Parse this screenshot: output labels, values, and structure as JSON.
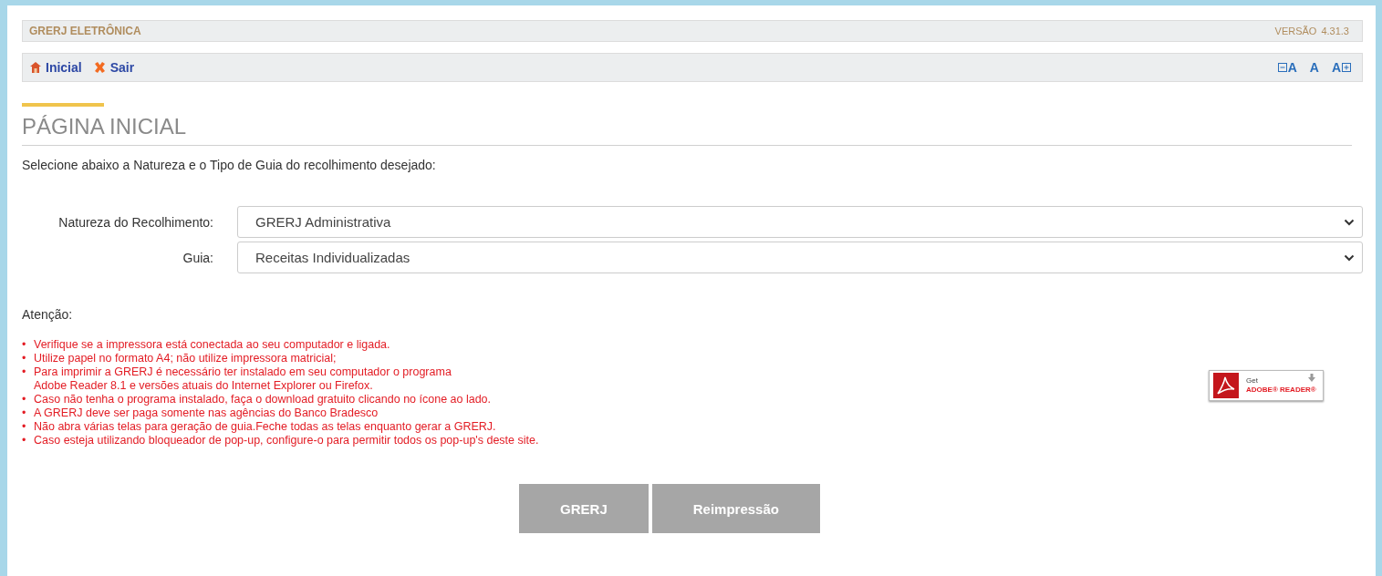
{
  "header": {
    "title": "GRERJ ELETRÔNICA",
    "version_label": "VERSÃO",
    "version": "4.31.3"
  },
  "nav": [
    {
      "kind": "home",
      "label": "Inicial"
    },
    {
      "kind": "exit",
      "label": "Sair"
    }
  ],
  "font_controls": [
    {
      "kind": "decrease",
      "label": "A"
    },
    {
      "kind": "normal",
      "label": "A"
    },
    {
      "kind": "increase",
      "label": "A"
    }
  ],
  "page_title": "PÁGINA INICIAL",
  "intro": "Selecione abaixo a Natureza e o Tipo de Guia do recolhimento desejado:",
  "fields": [
    {
      "label": "Natureza do Recolhimento:",
      "value": "GRERJ Administrativa"
    },
    {
      "label": "Guia:",
      "value": "Receitas Individualizadas"
    }
  ],
  "attention": {
    "title": "Atenção:",
    "marker": "•",
    "items": [
      "Verifique se a impressora está conectada ao seu computador e ligada.",
      "Utilize papel no formato A4; não utilize impressora matricial;",
      "Para imprimir a GRERJ é necessário ter instalado em seu computador o programa\nAdobe Reader 8.1 e versões atuais do Internet Explorer ou Firefox.",
      "Caso não tenha o programa instalado, faça o download gratuito clicando no ícone ao lado.",
      "A GRERJ deve ser paga somente nas agências do Banco Bradesco",
      "Não abra várias telas para geração de guia.Feche todas as telas enquanto gerar a GRERJ.",
      "Caso esteja utilizando bloqueador de pop-up, configure-o para permitir todos os pop-up's deste site."
    ]
  },
  "adobe_badge": {
    "line1": "Get",
    "line2": "ADOBE® READER®"
  },
  "buttons": [
    {
      "label": "GRERJ",
      "disabled": true
    },
    {
      "label": "Reimpressão",
      "disabled": true
    }
  ]
}
